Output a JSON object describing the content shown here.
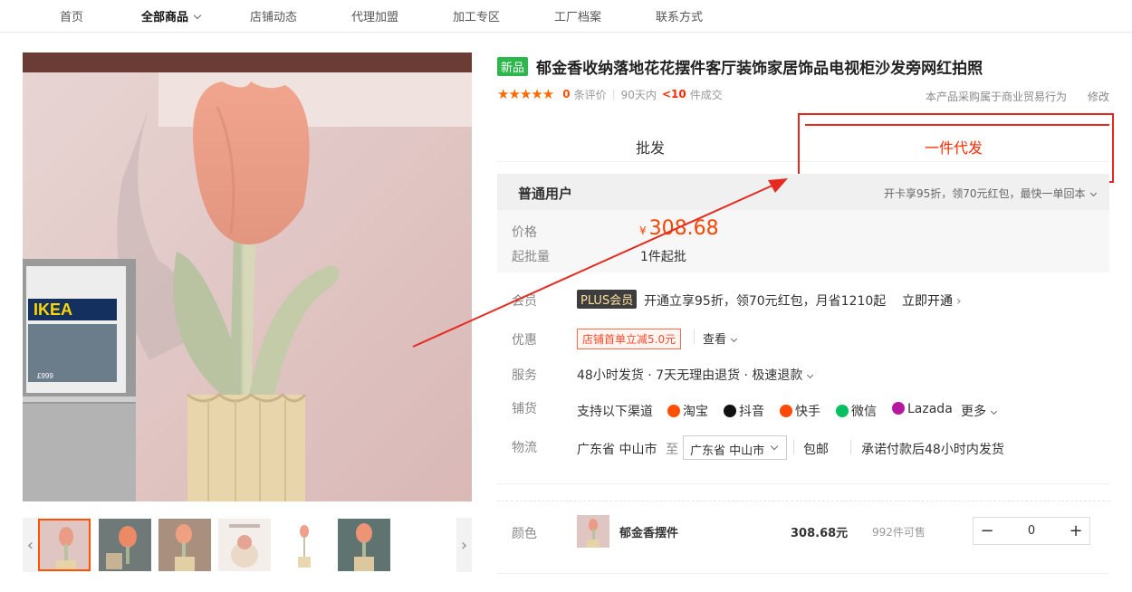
{
  "nav": [
    "首页",
    "全部商品",
    "店铺动态",
    "代理加盟",
    "加工专区",
    "工厂档案",
    "联系方式"
  ],
  "product": {
    "badge": "新品",
    "title": "郁金香收纳落地花花摆件客厅装饰家居饰品电视柜沙发旁网红拍照",
    "stars": "★★★★★",
    "review_count": "0",
    "review_label": "条评价",
    "sold_period": "90天内",
    "sold_count": "<10",
    "sold_label": "件成交",
    "purchase_note": "本产品采购属于商业贸易行为",
    "edit_label": "修改"
  },
  "tabs": {
    "wholesale": "批发",
    "dropship": "一件代发"
  },
  "user_bar": {
    "title": "普通用户",
    "promo": "开卡享95折，领70元红包，最快一单回本"
  },
  "price": {
    "label": "价格",
    "currency": "¥",
    "value": "308.68",
    "moq_label": "起批量",
    "moq_value": "1件起批"
  },
  "member": {
    "label": "会员",
    "badge": "PLUS会员",
    "text": "开通立享95折，领70元红包，月省1210起",
    "link": "立即开通"
  },
  "discount": {
    "label": "优惠",
    "coupon": "店铺首单立减5.0元",
    "view": "查看"
  },
  "service": {
    "label": "服务",
    "text": "48小时发货 · 7天无理由退货 · 极速退款"
  },
  "channels": {
    "label": "铺货",
    "intro": "支持以下渠道",
    "items": [
      "淘宝",
      "抖音",
      "快手",
      "微信",
      "Lazada"
    ],
    "more": "更多",
    "colors": [
      "#ff5000",
      "#111111",
      "#ff4906",
      "#07c160",
      "#b5179e"
    ]
  },
  "logistics": {
    "label": "物流",
    "from": "广东省 中山市",
    "to_label": "至",
    "to": "广东省 中山市",
    "shipping": "包邮",
    "promise": "承诺付款后48小时内发货"
  },
  "variant": {
    "label": "颜色",
    "name": "郁金香摆件",
    "price": "308.68元",
    "stock": "992件可售",
    "qty": "0",
    "minus": "−",
    "plus": "+"
  },
  "main_image_text": {
    "brand": "IKEA",
    "price": "£999"
  }
}
